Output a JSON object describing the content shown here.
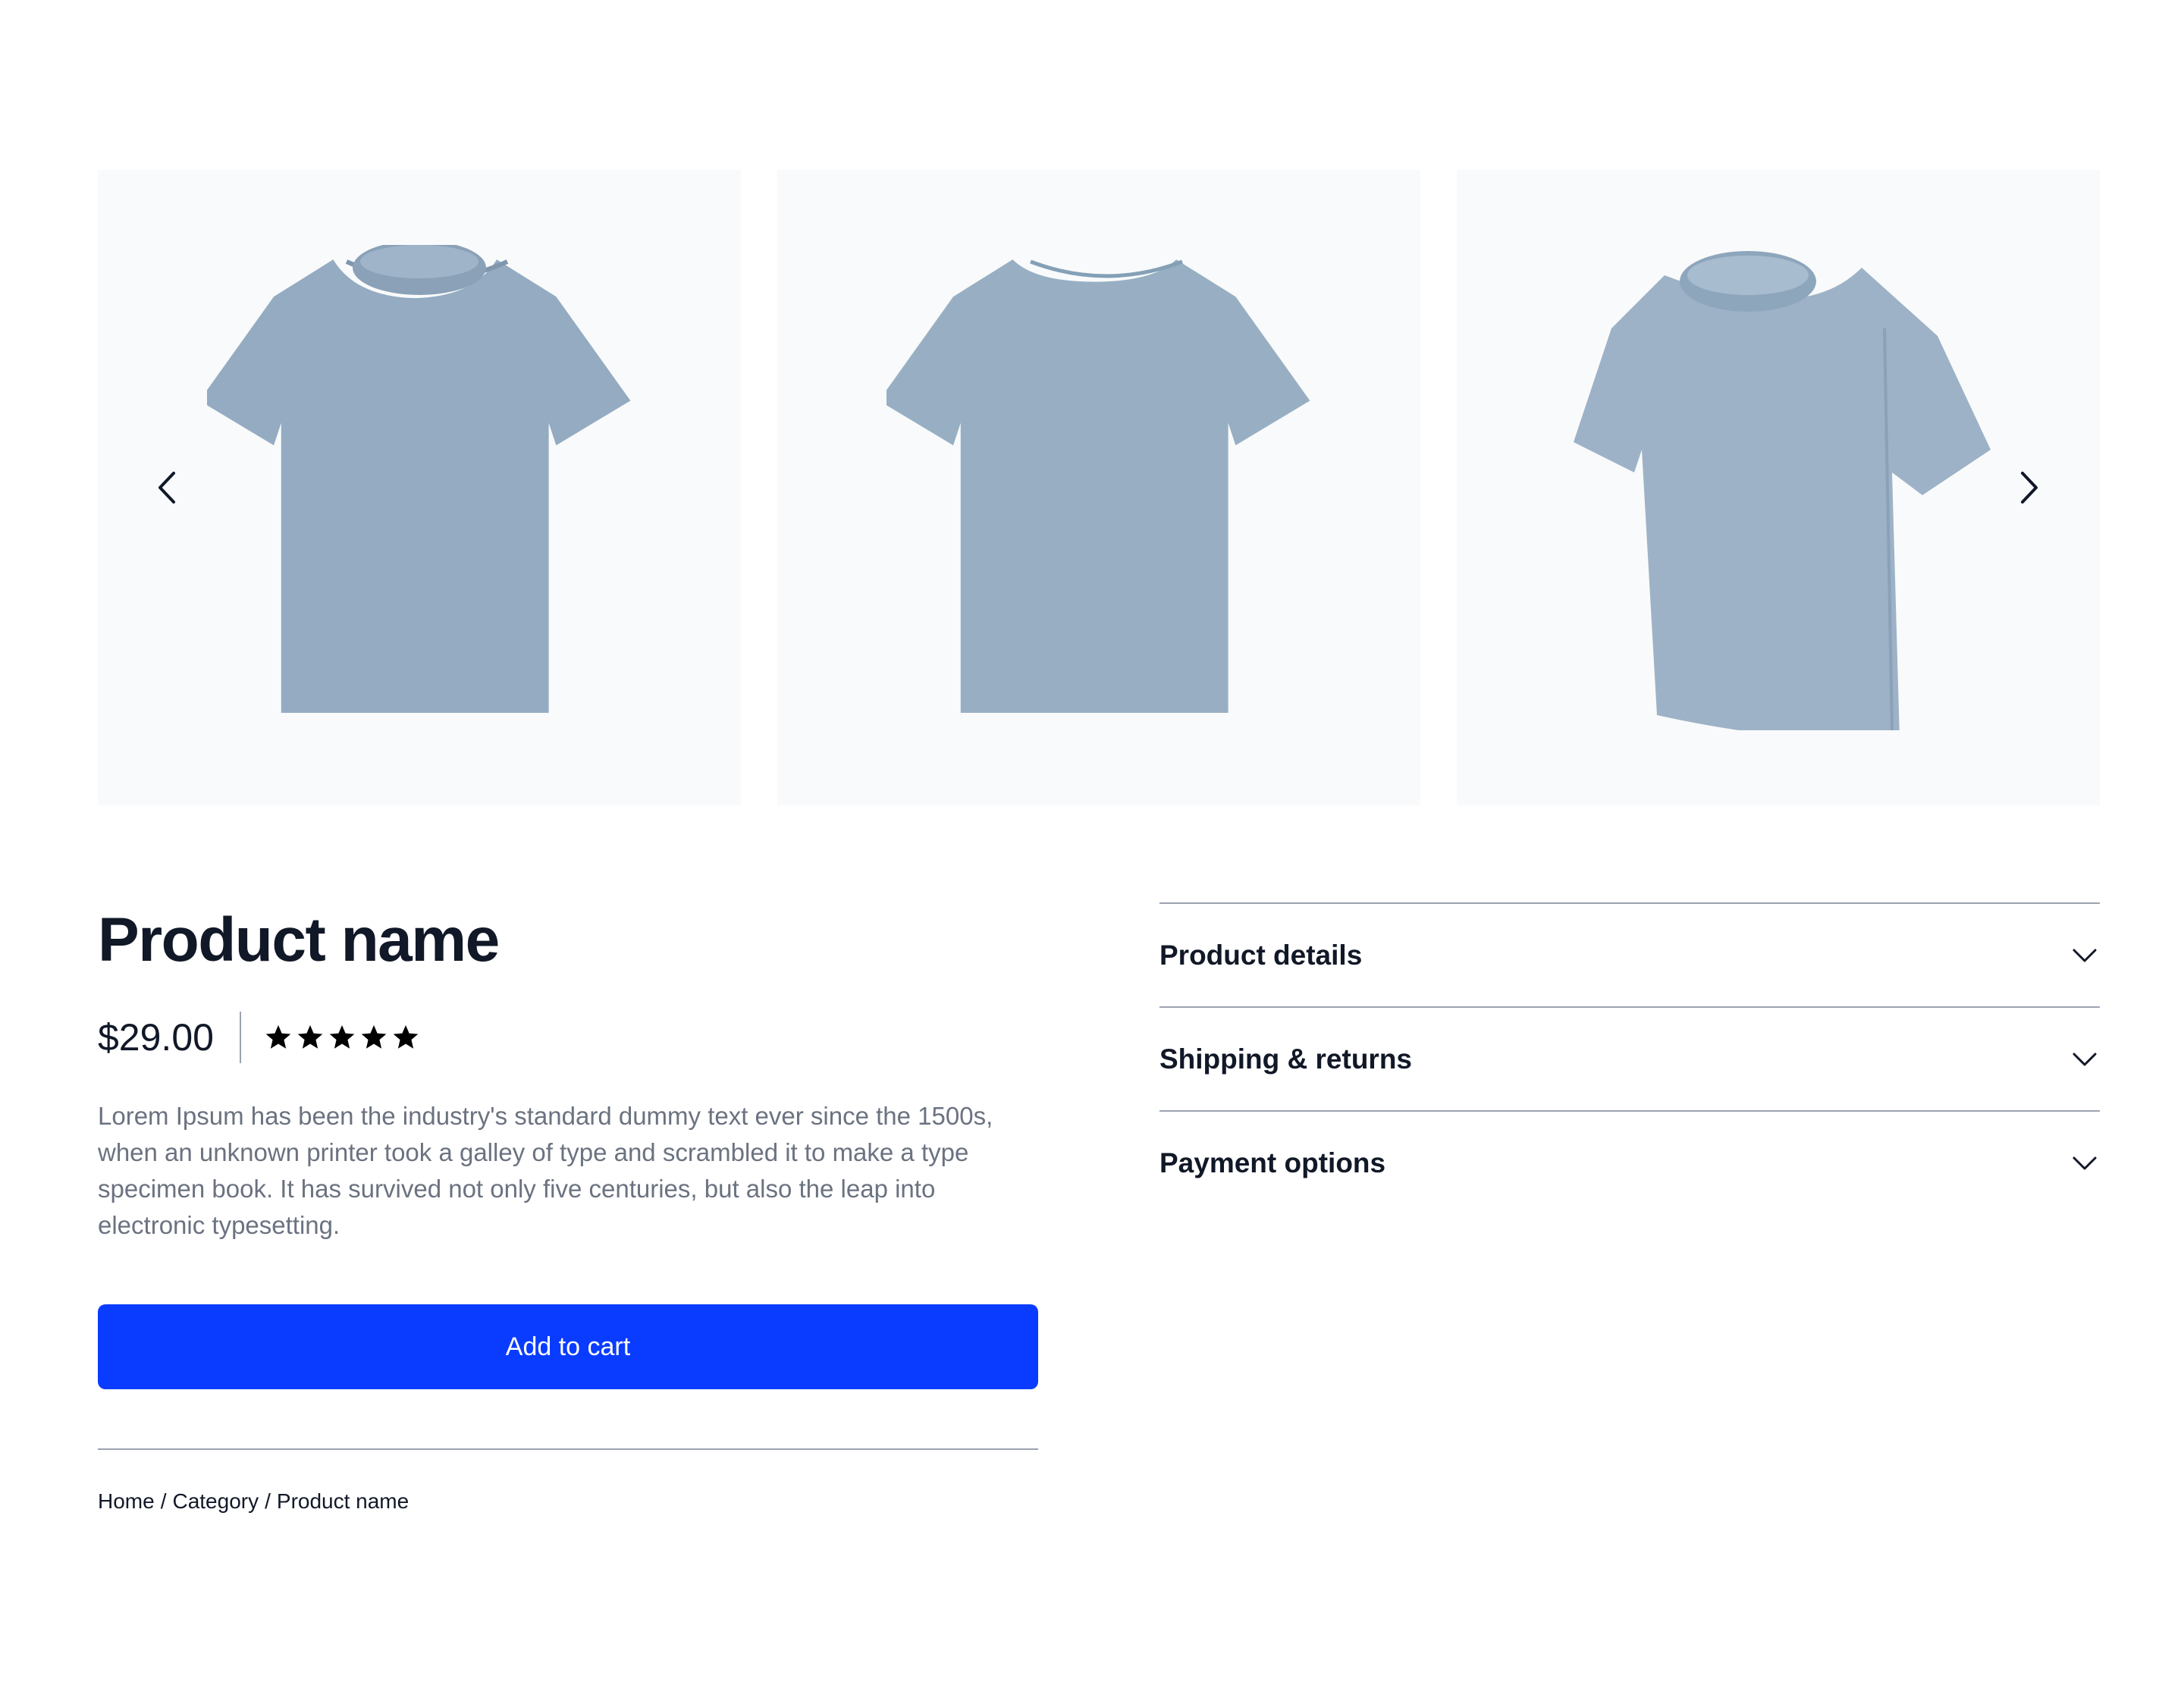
{
  "gallery": {
    "images": [
      {
        "view": "front",
        "label": "tshirt-front"
      },
      {
        "view": "back",
        "label": "tshirt-back"
      },
      {
        "view": "side",
        "label": "tshirt-side"
      }
    ],
    "prev_icon": "chevron-left-icon",
    "next_icon": "chevron-right-icon",
    "shirt_color": "#94abc2"
  },
  "product": {
    "name": "Product name",
    "price": "$29.00",
    "rating": 5,
    "rating_max": 5,
    "description": "Lorem Ipsum has been the industry's standard dummy text ever since the 1500s, when an unknown printer took a galley of type and scrambled it to make a type specimen book. It has survived not only five centuries, but also the leap into electronic typesetting.",
    "add_to_cart_label": "Add to cart"
  },
  "breadcrumb": {
    "items": [
      "Home",
      "Category",
      "Product name"
    ],
    "separator": "/"
  },
  "accordion": {
    "items": [
      {
        "label": "Product details"
      },
      {
        "label": "Shipping & returns"
      },
      {
        "label": "Payment options"
      }
    ]
  },
  "colors": {
    "accent": "#0a3cff",
    "text_primary": "#111827",
    "text_secondary": "#6b7280",
    "divider": "#9ca3af",
    "tile_background": "#f9fafb"
  }
}
